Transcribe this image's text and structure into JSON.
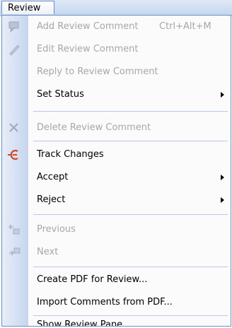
{
  "menubar": {
    "title": "Review"
  },
  "menu": {
    "add_comment": {
      "label": "Add Review Comment",
      "shortcut": "Ctrl+Alt+M"
    },
    "edit_comment": {
      "label": "Edit Review Comment"
    },
    "reply_comment": {
      "label": "Reply to Review Comment"
    },
    "set_status": {
      "label": "Set Status"
    },
    "delete_comment": {
      "label": "Delete Review Comment"
    },
    "track_changes": {
      "label": "Track Changes"
    },
    "accept": {
      "label": "Accept"
    },
    "reject": {
      "label": "Reject"
    },
    "previous": {
      "label": "Previous"
    },
    "next": {
      "label": "Next"
    },
    "create_pdf": {
      "label": "Create PDF for Review..."
    },
    "import_comments": {
      "label": "Import Comments from PDF..."
    },
    "show_pane": {
      "label": "Show Review Pane"
    }
  },
  "colors": {
    "disabled_text": "#a7a7a7",
    "gutter": "#c5d5ee",
    "menu_border": "#6f8fc1",
    "track_changes_icon": "#d1451f"
  },
  "icons": {
    "add_comment": "add-comment-icon",
    "edit_comment": "pencil-icon",
    "delete_comment": "delete-x-icon",
    "track_changes": "track-changes-icon",
    "previous": "previous-change-icon",
    "next": "next-change-icon"
  }
}
